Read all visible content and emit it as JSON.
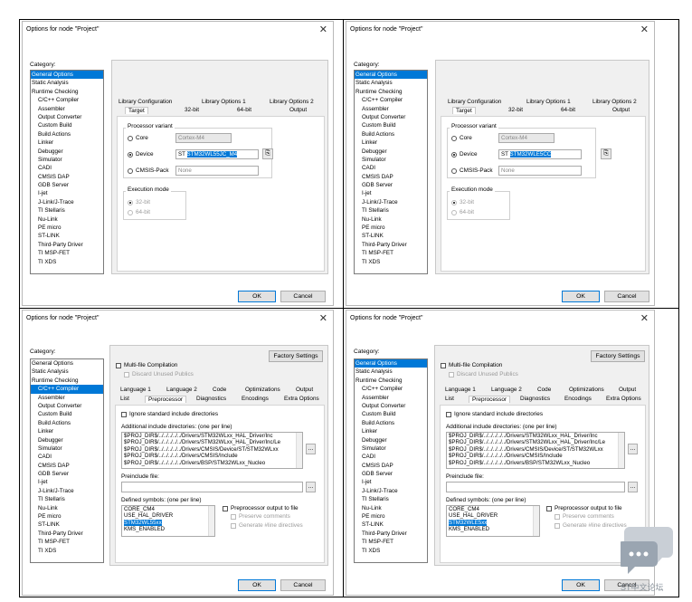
{
  "dialog_title": "Options for node \"Project\"",
  "category_label": "Category:",
  "categories": [
    {
      "label": "General Options",
      "indent": false
    },
    {
      "label": "Static Analysis",
      "indent": false
    },
    {
      "label": "Runtime Checking",
      "indent": false
    },
    {
      "label": "C/C++ Compiler",
      "indent": true
    },
    {
      "label": "Assembler",
      "indent": true
    },
    {
      "label": "Output Converter",
      "indent": true
    },
    {
      "label": "Custom Build",
      "indent": true
    },
    {
      "label": "Build Actions",
      "indent": true
    },
    {
      "label": "Linker",
      "indent": true
    },
    {
      "label": "Debugger",
      "indent": true
    },
    {
      "label": "Simulator",
      "indent": true
    },
    {
      "label": "CADI",
      "indent": true
    },
    {
      "label": "CMSIS DAP",
      "indent": true
    },
    {
      "label": "GDB Server",
      "indent": true
    },
    {
      "label": "I-jet",
      "indent": true
    },
    {
      "label": "J-Link/J-Trace",
      "indent": true
    },
    {
      "label": "TI Stellaris",
      "indent": true
    },
    {
      "label": "Nu-Link",
      "indent": true
    },
    {
      "label": "PE micro",
      "indent": true
    },
    {
      "label": "ST-LINK",
      "indent": true
    },
    {
      "label": "Third-Party Driver",
      "indent": true
    },
    {
      "label": "TI MSP-FET",
      "indent": true
    },
    {
      "label": "TI XDS",
      "indent": true
    }
  ],
  "general": {
    "tabs_row1": [
      "Library Configuration",
      "Library Options 1",
      "Library Options 2"
    ],
    "tabs_row2": [
      "Target",
      "32-bit",
      "64-bit",
      "Output"
    ],
    "processor_variant": "Processor variant",
    "core_label": "Core",
    "core_value": "Cortex-M4",
    "device_label": "Device",
    "device_prefix": "ST",
    "cmsis_label": "CMSIS-Pack",
    "cmsis_value": "None",
    "exec_mode": "Execution mode",
    "bit32": "32-bit",
    "bit64": "64-bit"
  },
  "compiler": {
    "multifile": "Multi-file Compilation",
    "discard": "Discard Unused Publics",
    "factory": "Factory Settings",
    "tabs_row1": [
      "Language 1",
      "Language 2",
      "Code",
      "Optimizations",
      "Output"
    ],
    "tabs_row2": [
      "List",
      "Preprocessor",
      "Diagnostics",
      "Encodings",
      "Extra Options"
    ],
    "ignore": "Ignore standard include directories",
    "add_inc": "Additional include directories: (one per line)",
    "includes": [
      "$PROJ_DIR$/../../../../../Drivers/STM32WLxx_HAL_Driver/Inc",
      "$PROJ_DIR$/../../../../../Drivers/STM32WLxx_HAL_Driver/Inc/Le",
      "$PROJ_DIR$/../../../../../Drivers/CMSIS/Device/ST/STM32WLxx",
      "$PROJ_DIR$/../../../../../Drivers/CMSIS/Include",
      "$PROJ_DIR$/../../../../../Drivers/BSP/STM32WLxx_Nucleo"
    ],
    "preinclude": "Preinclude file:",
    "defined": "Defined symbols: (one per line)",
    "pp_out": "Preprocessor output to file",
    "preserve": "Preserve comments",
    "gen_line": "Generate #line directives",
    "sym1": "CORE_CM4",
    "sym2": "USE_HAL_DRIVER",
    "sym4": "KMS_ENABLED"
  },
  "ok": "OK",
  "cancel": "Cancel",
  "ellipsis": "...",
  "panels": {
    "tl": {
      "device": "STM32WL55JC_M4",
      "symbol": ""
    },
    "tr": {
      "device": "STM32WLE5CC",
      "symbol": ""
    },
    "bl": {
      "device": "",
      "symbol": "STM32WL55xx"
    },
    "br": {
      "device": "",
      "symbol": "STM32WLE5xx"
    }
  },
  "watermark": "ST中文论坛",
  "colors": {
    "selection": "#0078d7",
    "panel": "#f0f0f0"
  }
}
